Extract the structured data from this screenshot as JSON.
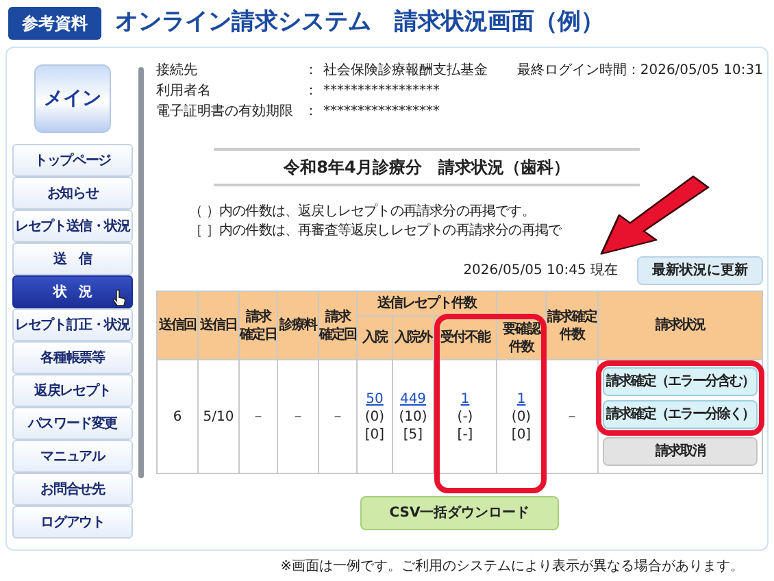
{
  "header": {
    "badge": "参考資料",
    "title": "オンライン請求システム　請求状況画面（例）"
  },
  "sidebar": {
    "main_button": "メイン",
    "items": [
      {
        "label": "トップページ",
        "selected": false
      },
      {
        "label": "お知らせ",
        "selected": false
      },
      {
        "label": "レセプト送信・状況",
        "selected": false
      },
      {
        "label": "送　信",
        "selected": false
      },
      {
        "label": "状　況",
        "selected": true
      },
      {
        "label": "レセプト訂正・状況",
        "selected": false
      },
      {
        "label": "各種帳票等",
        "selected": false
      },
      {
        "label": "返戻レセプト",
        "selected": false
      },
      {
        "label": "パスワード変更",
        "selected": false
      },
      {
        "label": "マニュアル",
        "selected": false
      },
      {
        "label": "お問合せ先",
        "selected": false
      },
      {
        "label": "ログアウト",
        "selected": false
      }
    ]
  },
  "info": {
    "rows": [
      {
        "label": "接続先",
        "colon": "：",
        "value": "社会保険診療報酬支払基金"
      },
      {
        "label": "利用者名",
        "colon": "：",
        "value": "*****************"
      },
      {
        "label": "電子証明書の有効期限",
        "colon": "：",
        "value": "*****************"
      }
    ],
    "last_login": "最終ログイン時間：2026/05/05 10:31"
  },
  "heading": "令和8年4月診療分　請求状況（歯科）",
  "notes": [
    "（ ）内の件数は、返戻しレセプトの再請求分の再掲です。",
    "［ ］内の件数は、再審査等返戻しレセプトの再請求分の再掲で"
  ],
  "timestamp": "2026/05/05 10:45 現在",
  "refresh_button": "最新状況に更新",
  "pointer_arrow": true,
  "table": {
    "columns": [
      {
        "lines": [
          "送信回"
        ]
      },
      {
        "lines": [
          "送信日"
        ]
      },
      {
        "lines": [
          "請求",
          "確定日"
        ]
      },
      {
        "lines": [
          "診療料"
        ]
      },
      {
        "lines": [
          "請求",
          "確定回"
        ]
      },
      {
        "lines": [
          "入院"
        ],
        "grouped": true,
        "highlighted": false
      },
      {
        "lines": [
          "入院外"
        ],
        "grouped": true,
        "highlighted": false
      },
      {
        "lines": [
          "受付不能"
        ],
        "grouped": true,
        "highlighted": true
      },
      {
        "lines": [
          "要確認",
          "件数"
        ],
        "highlighted": true
      },
      {
        "lines": [
          "請求確定",
          "件数"
        ]
      },
      {
        "lines": [
          "請求状況"
        ]
      }
    ],
    "column_groups": [
      {
        "label": "送信レセプト件数"
      }
    ],
    "rows": [
      {
        "cells": [
          {
            "lines": [
              {
                "text": "6",
                "link": false
              }
            ]
          },
          {
            "lines": [
              {
                "text": "5/10",
                "link": false
              }
            ]
          },
          {
            "lines": [
              {
                "text": "－",
                "link": false
              }
            ]
          },
          {
            "lines": [
              {
                "text": "－",
                "link": false
              }
            ]
          },
          {
            "lines": [
              {
                "text": "－",
                "link": false
              }
            ]
          },
          {
            "lines": [
              {
                "text": "50",
                "link": true
              },
              {
                "text": "(0)",
                "link": false
              },
              {
                "text": "[0]",
                "link": false
              }
            ]
          },
          {
            "lines": [
              {
                "text": "449",
                "link": true
              },
              {
                "text": "(10)",
                "link": false
              },
              {
                "text": "[5]",
                "link": false
              }
            ]
          },
          {
            "lines": [
              {
                "text": "1",
                "link": true
              },
              {
                "text": "(-)",
                "link": false
              },
              {
                "text": "[-]",
                "link": false
              }
            ]
          },
          {
            "lines": [
              {
                "text": "1",
                "link": true
              },
              {
                "text": "(0)",
                "link": false
              },
              {
                "text": "[0]",
                "link": false
              }
            ]
          },
          {
            "lines": [
              {
                "text": "－",
                "link": false
              }
            ]
          }
        ],
        "actions": [
          {
            "label": "請求確定（エラー分含む）",
            "kind": "confirm",
            "highlighted": true
          },
          {
            "label": "請求確定（エラー分除く）",
            "kind": "confirm",
            "highlighted": true
          },
          {
            "label": "請求取消",
            "kind": "cancel",
            "highlighted": false
          }
        ]
      }
    ]
  },
  "csv_button": "CSV一括ダウンロード",
  "footnote": "※画面は一例です。ご利用のシステムにより表示が異なる場合があります。"
}
